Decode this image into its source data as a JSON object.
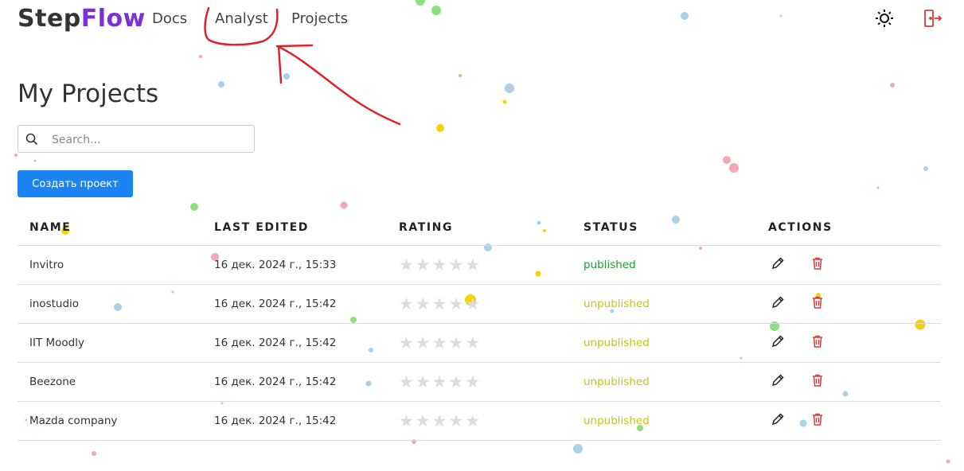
{
  "header": {
    "logo": {
      "part1": "Step",
      "part2": "Flow"
    },
    "nav": [
      {
        "label": "Docs"
      },
      {
        "label": "Analyst"
      },
      {
        "label": "Projects"
      }
    ],
    "icons": [
      "sun-icon",
      "logout-icon"
    ]
  },
  "main": {
    "title": "My Projects",
    "search": {
      "placeholder": "Search...",
      "value": ""
    },
    "create_button": "Создать проект"
  },
  "table": {
    "columns": [
      "NAME",
      "LAST EDITED",
      "RATING",
      "STATUS",
      "ACTIONS"
    ],
    "rows": [
      {
        "name": "Invitro",
        "last_edited": "16 дек. 2024 г., 15:33",
        "rating": 0,
        "status": "published"
      },
      {
        "name": "inostudio",
        "last_edited": "16 дек. 2024 г., 15:42",
        "rating": 0,
        "status": "unpublished"
      },
      {
        "name": "IIT Moodly",
        "last_edited": "16 дек. 2024 г., 15:42",
        "rating": 0,
        "status": "unpublished"
      },
      {
        "name": "Beezone",
        "last_edited": "16 дек. 2024 г., 15:42",
        "rating": 0,
        "status": "unpublished"
      },
      {
        "name": "Mazda company",
        "last_edited": "16 дек. 2024 г., 15:42",
        "rating": 0,
        "status": "unpublished"
      }
    ],
    "actions": [
      "pencil-icon",
      "trash-icon"
    ]
  },
  "colors": {
    "brand_purple": "#7b2fe0",
    "primary_button": "#1b84f0",
    "published": "#1f9c31",
    "unpublished": "#c9c213",
    "delete_icon": "#d93a3a",
    "annotation": "#e0202a",
    "star_empty": "#dcdcdc"
  }
}
